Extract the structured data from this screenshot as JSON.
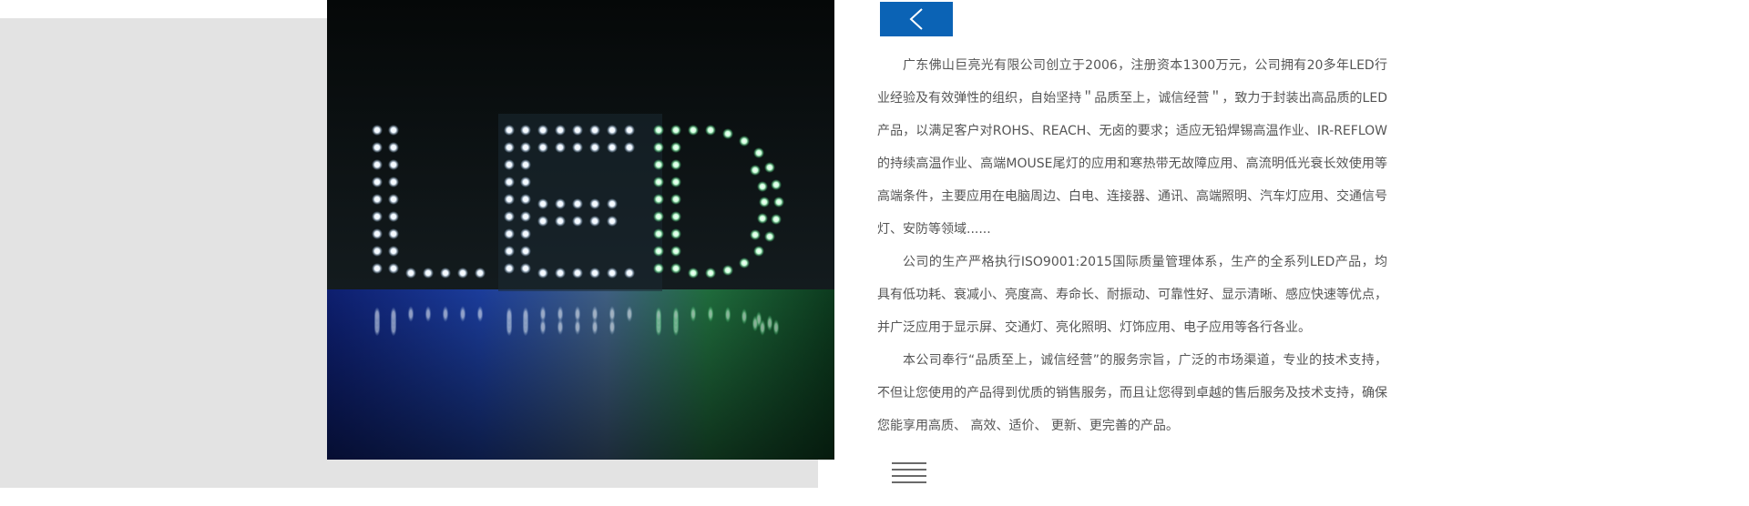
{
  "hero": {
    "image": "led-sign-photo",
    "image_text": "LED"
  },
  "nav": {
    "back_icon": "chevron-left-icon",
    "menu_icon": "hamburger-menu-icon"
  },
  "about": {
    "paragraphs": [
      "广东佛山巨亮光有限公司创立于2006，注册资本1300万元，公司拥有20多年LED行业经验及有效弹性的组织，自始坚持＂品质至上，诚信经营＂，致力于封装出高品质的LED产品，以满足客户对ROHS、REACH、无卤的要求；适应无铅焊锡高温作业、IR-REFLOW的持续高温作业、高端MOUSE尾灯的应用和寒热带无故障应用、高流明低光衰长效使用等高端条件，主要应用在电脑周边、白电、连接器、通讯、高端照明、汽车灯应用、交通信号灯、安防等领域......",
      "公司的生产严格执行ISO9001:2015国际质量管理体系，生产的全系列LED产品，均具有低功耗、衰减小、亮度高、寿命长、耐振动、可靠性好、显示清晰、感应快速等优点，并广泛应用于显示屏、交通灯、亮化照明、灯饰应用、电子应用等各行各业。",
      "本公司奉行“品质至上，诚信经营”的服务宗旨，广泛的市场渠道，专业的技术支持，不但让您使用的产品得到优质的销售服务，而且让您得到卓越的售后服务及技术支持，确保您能享用高质、 高效、适价、 更新、更完善的产品。"
    ]
  },
  "colors": {
    "accent": "#0b63b5",
    "panel": "#e3e3e3",
    "text": "#555555"
  }
}
